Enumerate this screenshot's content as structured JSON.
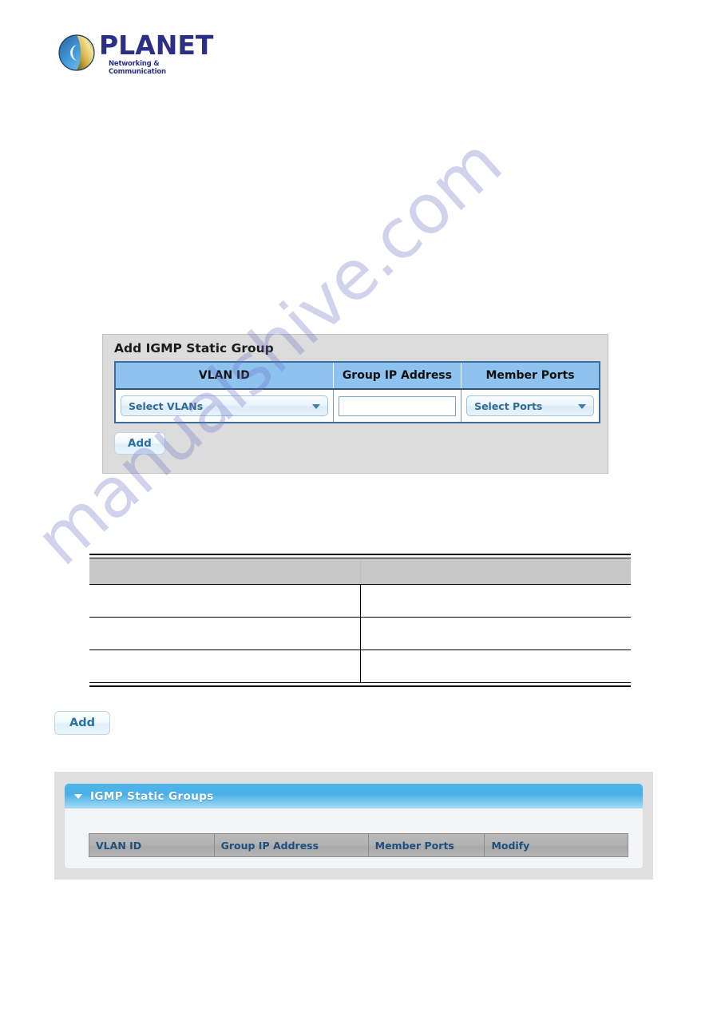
{
  "brand": {
    "name": "PLANET",
    "tagline": "Networking & Communication",
    "logo_icon": "planet-globe-icon"
  },
  "watermark": {
    "text": "manualshive.com",
    "color": "#6b6fc4"
  },
  "add_panel": {
    "title": "Add IGMP Static Group",
    "columns": [
      "VLAN ID",
      "Group IP Address",
      "Member Ports"
    ],
    "vlan_select": {
      "value": "Select VLANs",
      "icon": "chevron-down-icon"
    },
    "group_ip_input": {
      "value": "",
      "placeholder": ""
    },
    "ports_select": {
      "value": "Select Ports",
      "icon": "chevron-down-icon"
    },
    "add_label": "Add"
  },
  "description_table": {
    "headers": [
      "",
      ""
    ],
    "rows": [
      [
        "",
        ""
      ],
      [
        "",
        ""
      ],
      [
        "",
        ""
      ]
    ]
  },
  "standalone_button": {
    "label": "Add"
  },
  "groups_panel": {
    "title": "IGMP Static Groups",
    "collapse_icon": "caret-down-icon",
    "columns": [
      "VLAN ID",
      "Group IP Address",
      "Member Ports",
      "Modify"
    ],
    "rows": []
  },
  "colors": {
    "panel_bg": "#dcdcdc",
    "table_header_blue": "#8fc3ef",
    "table_border_blue": "#3d6f9e",
    "panel_header_blue": "#4fb4e8",
    "link_blue": "#2d6b9a",
    "logo_blue": "#2b2f86",
    "grey_header": "#b2b2b2",
    "desc_header_grey": "#c8c8c8"
  }
}
